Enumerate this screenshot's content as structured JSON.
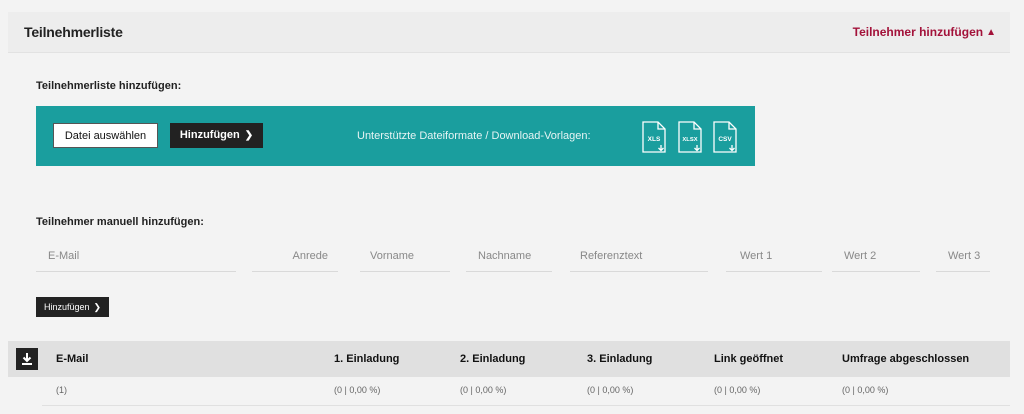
{
  "header": {
    "title": "Teilnehmerliste",
    "add_link": "Teilnehmer hinzufügen"
  },
  "upload": {
    "section_label": "Teilnehmerliste hinzufügen:",
    "choose_file": "Datei auswählen",
    "add_button": "Hinzufügen",
    "formats_label": "Unterstützte Dateiformate / Download-Vorlagen:",
    "formats": [
      "XLS",
      "XLSX",
      "CSV"
    ]
  },
  "manual": {
    "section_label": "Teilnehmer manuell hinzufügen:",
    "fields": {
      "email": "E-Mail",
      "salutation": "Anrede",
      "firstname": "Vorname",
      "lastname": "Nachname",
      "reference": "Referenztext",
      "value1": "Wert 1",
      "value2": "Wert 2",
      "value3": "Wert 3"
    },
    "add_button": "Hinzufügen"
  },
  "table": {
    "headers": [
      "E-Mail",
      "1. Einladung",
      "2. Einladung",
      "3. Einladung",
      "Link geöffnet",
      "Umfrage abgeschlossen"
    ],
    "row": [
      "(1)",
      "(0 | 0,00 %)",
      "(0 | 0,00 %)",
      "(0 | 0,00 %)",
      "(0 | 0,00 %)",
      "(0 | 0,00 %)"
    ]
  },
  "colors": {
    "accent": "#a3123a",
    "teal": "#1a9e9e",
    "dark": "#222222"
  }
}
